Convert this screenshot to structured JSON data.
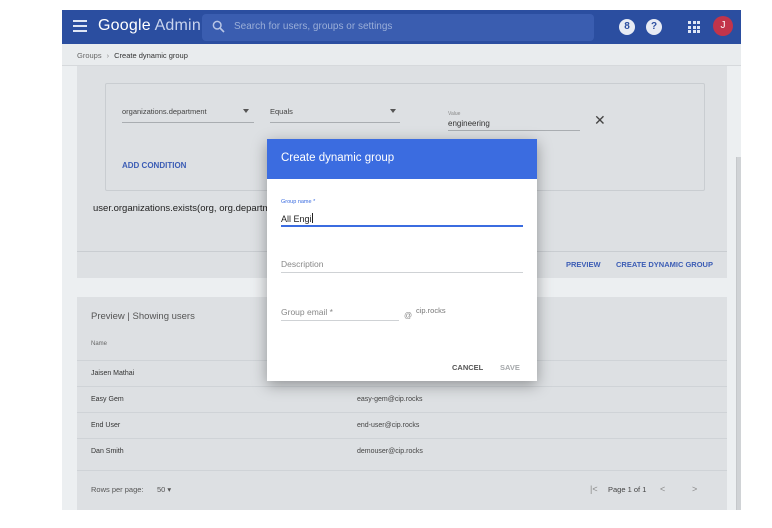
{
  "header": {
    "brand_google": "Google",
    "brand_admin": "Admin",
    "search_placeholder": "Search for users, groups or settings",
    "user_initial": "J",
    "help_glyph": "?",
    "alerts_glyph": "8"
  },
  "breadcrumb": {
    "parent": "Groups",
    "separator": "›",
    "current": "Create dynamic group"
  },
  "condition": {
    "attribute": "organizations.department",
    "operator": "Equals",
    "value_label": "Value",
    "value": "engineering",
    "remove_glyph": "✕",
    "add_label": "ADD CONDITION",
    "expression": "user.organizations.exists(org, org.department"
  },
  "actions": {
    "preview_label": "PREVIEW",
    "create_label": "CREATE DYNAMIC GROUP"
  },
  "preview": {
    "title": "Preview | Showing users",
    "name_header": "Name",
    "rows": [
      {
        "name": "Jaisen Mathai",
        "email": ""
      },
      {
        "name": "Easy Gem",
        "email": "easy-gem@cip.rocks"
      },
      {
        "name": "End User",
        "email": "end-user@cip.rocks"
      },
      {
        "name": "Dan Smith",
        "email": "demouser@cip.rocks"
      }
    ],
    "rows_per_page_label": "Rows per page:",
    "rows_per_page_value": "50 ▾",
    "first_page_glyph": "|<",
    "page_text": "Page 1 of 1",
    "prev_glyph": "<",
    "next_glyph": ">"
  },
  "dialog": {
    "title": "Create dynamic group",
    "group_name_label": "Group name *",
    "group_name_value": "All Engi",
    "description_placeholder": "Description",
    "email_placeholder": "Group email *",
    "at_glyph": "@",
    "domain": "cip.rocks",
    "cancel_label": "CANCEL",
    "save_label": "SAVE"
  },
  "colors": {
    "topbar": "#2b4ea0",
    "dialog_header": "#3b6ce0",
    "link_blue": "#3c5db5",
    "avatar": "#c2344a"
  }
}
